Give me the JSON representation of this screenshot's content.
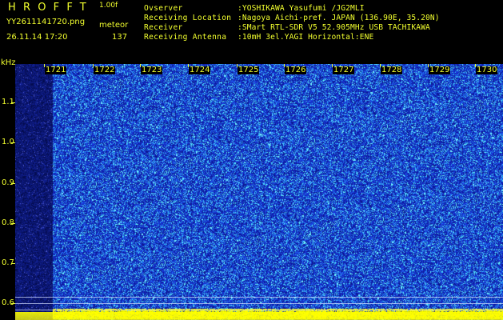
{
  "header": {
    "app_name": "HROFFT",
    "version": "1.00f",
    "file_name": "YY2611141720.png",
    "timestamp": "26.11.14 17:20",
    "mode": "meteor",
    "count": "137",
    "accent_color": "#f2ff2e"
  },
  "metadata": [
    {
      "label": "Ovserver",
      "value": ":YOSHIKAWA Yasufumi /JG2MLI"
    },
    {
      "label": "Receiving Location",
      "value": ":Nagoya Aichi-pref. JAPAN (136.90E, 35.20N)"
    },
    {
      "label": "Receiver",
      "value": ":SMart RTL-SDR V5 52.905MHz USB TACHIKAWA"
    },
    {
      "label": "Receiving Antenna",
      "value": ":10mH 3el.YAGI Horizontal:ENE"
    }
  ],
  "y_axis": {
    "unit": "kHz",
    "ticks": [
      "1.1",
      "1.0",
      "0.9",
      "0.8",
      "0.7",
      "0.6"
    ]
  },
  "x_axis": {
    "ticks": [
      "1721",
      "1722",
      "1723",
      "1724",
      "1725",
      "1726",
      "1727",
      "1728",
      "1729",
      "1730"
    ]
  },
  "spectrogram": {
    "background_color": "#1b2fcf",
    "noise_color": "#72f2ff",
    "footer_color": "#ffff00"
  }
}
